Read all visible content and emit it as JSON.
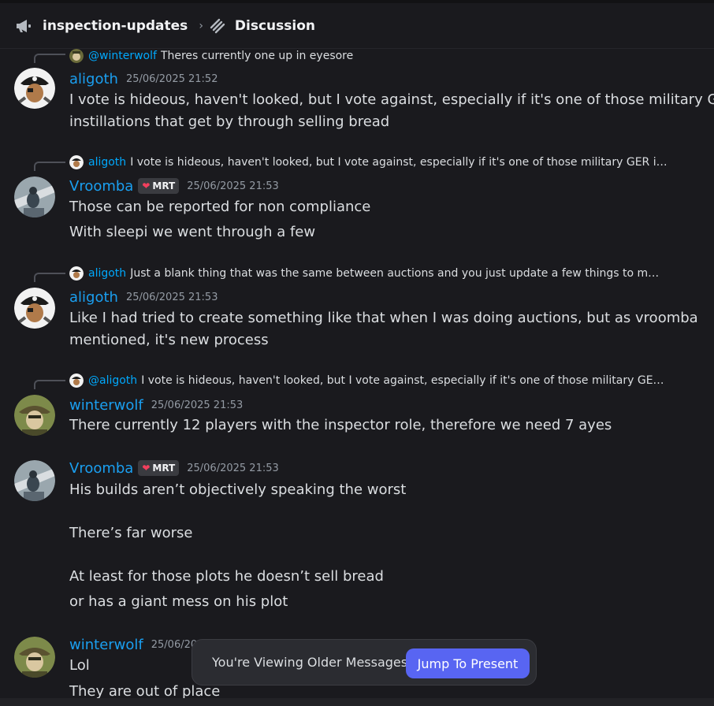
{
  "header": {
    "channel_name": "inspection-updates",
    "thread_name": "Discussion",
    "separator": "›"
  },
  "colors": {
    "username": "#1a9ff0",
    "mention": "#00a8fc",
    "accent_button": "#5865f2",
    "badge_heart": "#f23f5d"
  },
  "messages": [
    {
      "reply": {
        "name": "@winterwolf",
        "text": "Theres currently one up in eyesore"
      },
      "author": "aligoth",
      "badge": "",
      "timestamp": "25/06/2025 21:52",
      "lines": [
        "I vote is hideous, haven't looked, but I vote against, especially if it's one of those military GER",
        "instillations that get by through selling bread"
      ]
    },
    {
      "reply": {
        "name": "aligoth",
        "text": "I vote is hideous, haven't looked, but I vote against, especially if it's one of those military GER i…"
      },
      "author": "Vroomba",
      "badge": "MRT",
      "timestamp": "25/06/2025 21:53",
      "lines": [
        "Those can be reported for non compliance",
        "With sleepi we went through a few"
      ]
    },
    {
      "reply": {
        "name": "aligoth",
        "text": "Just a blank thing that was the same between auctions and you just update a few things to m…"
      },
      "author": "aligoth",
      "badge": "",
      "timestamp": "25/06/2025 21:53",
      "lines": [
        "Like I had tried to create something like that when I was doing auctions, but as vroomba",
        "mentioned, it's new process"
      ]
    },
    {
      "reply": {
        "name": "@aligoth",
        "text": "I vote is hideous, haven't looked, but I vote against, especially if it's one of those military GE…"
      },
      "author": "winterwolf",
      "badge": "",
      "timestamp": "25/06/2025 21:53",
      "lines": [
        "There currently 12 players with the inspector role, therefore we need 7 ayes"
      ]
    },
    {
      "author": "Vroomba",
      "badge": "MRT",
      "timestamp": "25/06/2025 21:53",
      "lines": [
        "His builds aren’t objectively speaking the worst",
        "There’s far worse",
        "At least for those plots he doesn’t sell bread",
        "or has a giant mess on his plot"
      ]
    },
    {
      "author": "winterwolf",
      "badge": "",
      "timestamp": "25/06/20",
      "lines": [
        "Lol",
        "They are out of place"
      ]
    }
  ],
  "toast": {
    "text": "You're Viewing Older Messages",
    "button": "Jump To Present"
  }
}
